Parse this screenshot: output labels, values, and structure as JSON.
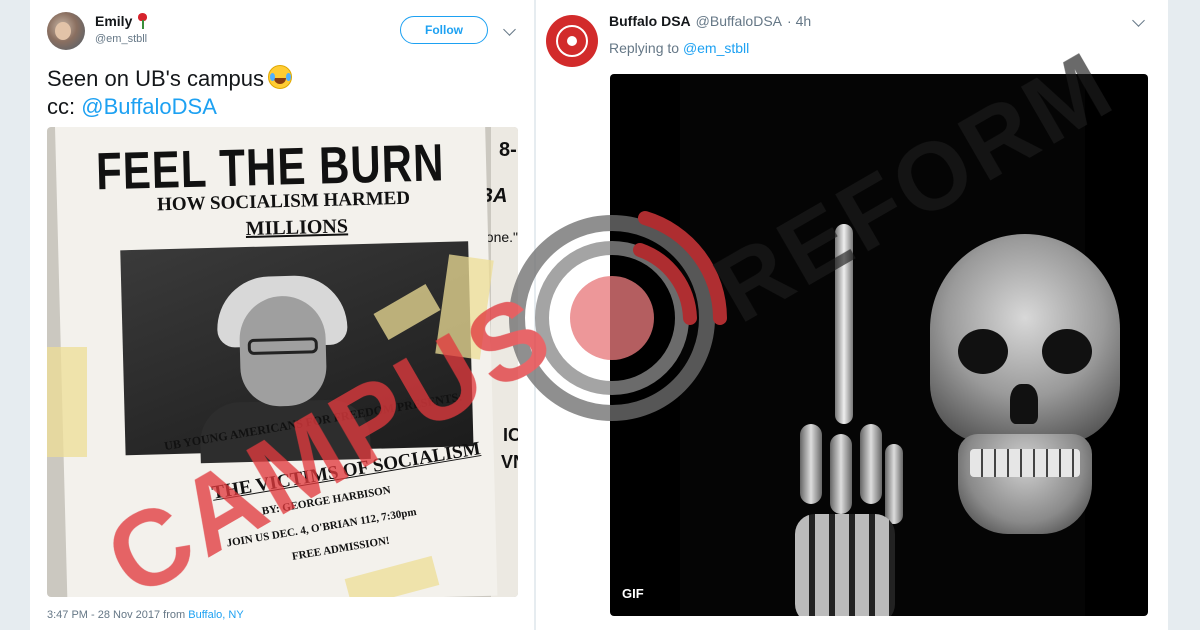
{
  "left_tweet": {
    "display_name": "Emily",
    "handle": "@em_stbll",
    "follow_label": "Follow",
    "text_line1": "Seen on UB's campus",
    "text_line2_prefix": "cc: ",
    "text_line2_mention": "@BuffaloDSA",
    "timestamp_prefix": "3:47 PM - 28 Nov 2017 from ",
    "timestamp_place": "Buffalo, NY",
    "poster": {
      "headline": "FEEL THE BURN",
      "subhead": "HOW SOCIALISM HARMED",
      "subhead2": "MILLIONS",
      "presents": "UB YOUNG AMERICANS FOR FREEDOM PRESENTS:",
      "event": "THE VICTIMS OF SOCIALISM",
      "speaker": "BY: GEORGE HARBISON",
      "join": "JOIN US DEC. 4, O'BRIAN 112, 7:30pm",
      "admission": "FREE ADMISSION!",
      "side_text_1": "8-",
      "side_text_2": ".BA",
      "side_text_3": "t zone.\"",
      "side_text_4": "ICE S",
      "side_text_5": "VNI"
    }
  },
  "right_tweet": {
    "display_name": "Buffalo DSA",
    "handle": "@BuffaloDSA",
    "time": "· 4h",
    "replying_prefix": "Replying to ",
    "replying_mention": "@em_stbll",
    "gif_label": "GIF"
  },
  "watermark": {
    "text_left": "CAMPUS",
    "text_right": "REFORM",
    "color": "#e03a3e"
  },
  "colors": {
    "link": "#1da1f2",
    "secondary_text": "#657786",
    "primary_text": "#14171a",
    "background": "#e6ecf0"
  }
}
